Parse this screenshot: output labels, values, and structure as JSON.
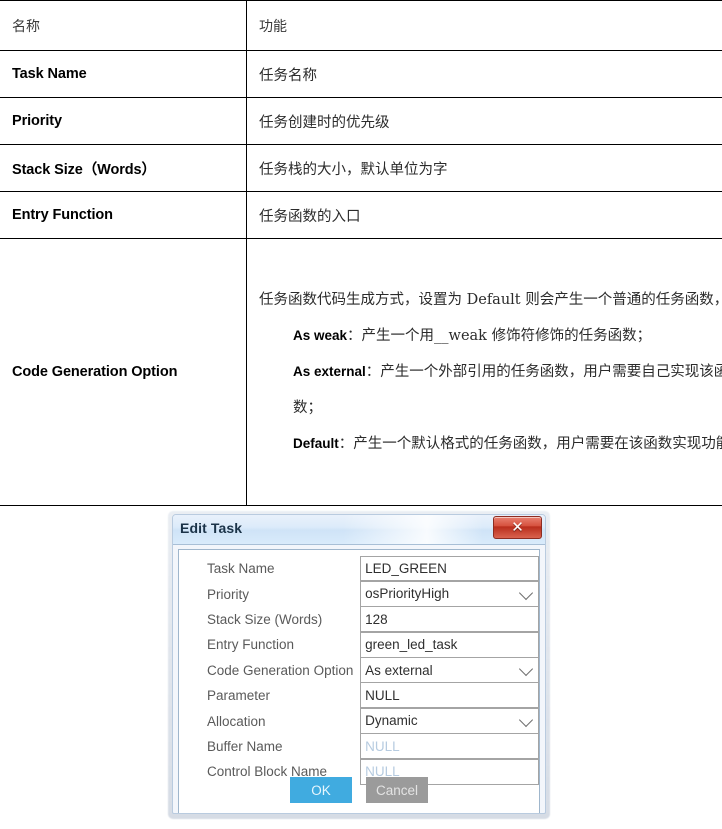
{
  "table": {
    "headers": [
      "名称",
      "功能"
    ],
    "rows": [
      {
        "name": "Task Name",
        "func": "任务名称"
      },
      {
        "name": "Priority",
        "func": "任务创建时的优先级"
      },
      {
        "name": "Stack Size（Words）",
        "func": "任务栈的大小，默认单位为字"
      },
      {
        "name": "Entry Function",
        "func": "任务函数的入口"
      }
    ],
    "cgo": {
      "name": "Code Generation Option",
      "intro": "任务函数代码生成方式，设置为 Default 则会产生一个普通的任务函数，",
      "items": [
        {
          "term": "As weak",
          "desc": "：产生一个用__weak 修饰符修饰的任务函数；"
        },
        {
          "term": "As external",
          "desc": "：产生一个外部引用的任务函数，用户需要自己实现该函数；"
        },
        {
          "term": "Default",
          "desc": "：产生一个默认格式的任务函数，用户需要在该函数实现功能。"
        }
      ]
    }
  },
  "dialog": {
    "title": "Edit Task",
    "close_icon": "close-icon",
    "fields": [
      {
        "label": "Task Name",
        "value": "LED_GREEN",
        "type": "text",
        "disabled": false
      },
      {
        "label": "Priority",
        "value": "osPriorityHigh",
        "type": "select",
        "disabled": false
      },
      {
        "label": "Stack Size (Words)",
        "value": "128",
        "type": "text",
        "disabled": false
      },
      {
        "label": "Entry Function",
        "value": "green_led_task",
        "type": "text",
        "disabled": false
      },
      {
        "label": "Code Generation Option",
        "value": "As external",
        "type": "select",
        "disabled": false
      },
      {
        "label": "Parameter",
        "value": "NULL",
        "type": "text",
        "disabled": false
      },
      {
        "label": "Allocation",
        "value": "Dynamic",
        "type": "select",
        "disabled": false
      },
      {
        "label": "Buffer Name",
        "value": "NULL",
        "type": "text",
        "disabled": true
      },
      {
        "label": "Control Block Name",
        "value": "NULL",
        "type": "text",
        "disabled": true
      }
    ],
    "buttons": {
      "ok": "OK",
      "cancel": "Cancel"
    },
    "colors": {
      "ok": "#40abe0",
      "cancel": "#9b9b9b",
      "close": "#b92d1c"
    }
  }
}
